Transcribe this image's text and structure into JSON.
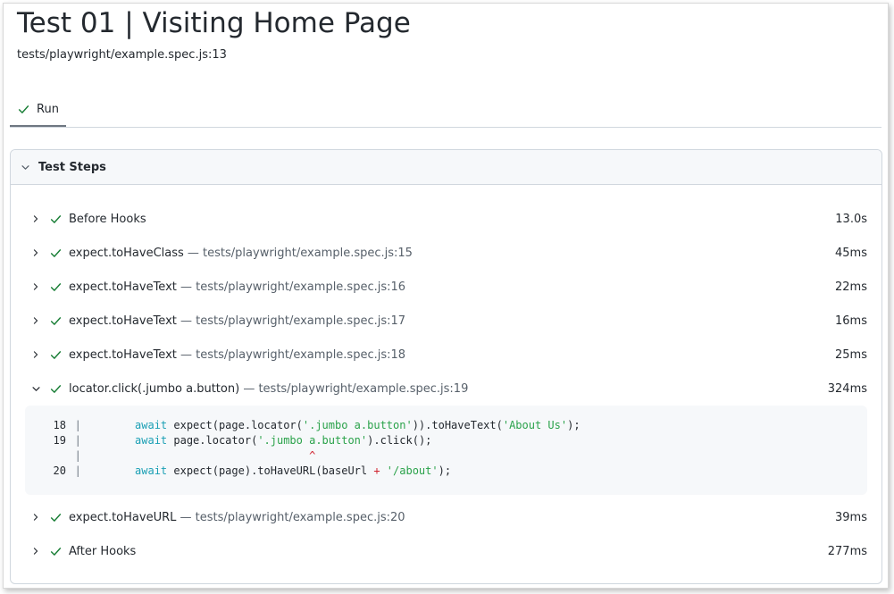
{
  "header": {
    "title": "Test 01 | Visiting Home Page",
    "location": "tests/playwright/example.spec.js:13"
  },
  "tabs": [
    {
      "label": "Run",
      "icon": "check-icon",
      "active": true
    }
  ],
  "panel": {
    "title": "Test Steps",
    "expanded": true
  },
  "colors": {
    "success": "#1a7f37",
    "keyword": "#1a9fb4",
    "string": "#2aa24a",
    "error": "#cf222e"
  },
  "steps": [
    {
      "title": "Before Hooks",
      "location": "",
      "duration": "13.0s",
      "expanded": false
    },
    {
      "title": "expect.toHaveClass",
      "location": "— tests/playwright/example.spec.js:15",
      "duration": "45ms",
      "expanded": false
    },
    {
      "title": "expect.toHaveText",
      "location": "— tests/playwright/example.spec.js:16",
      "duration": "22ms",
      "expanded": false
    },
    {
      "title": "expect.toHaveText",
      "location": "— tests/playwright/example.spec.js:17",
      "duration": "16ms",
      "expanded": false
    },
    {
      "title": "expect.toHaveText",
      "location": "— tests/playwright/example.spec.js:18",
      "duration": "25ms",
      "expanded": false
    },
    {
      "title": "locator.click(.jumbo a.button)",
      "location": "— tests/playwright/example.spec.js:19",
      "duration": "324ms",
      "expanded": true
    },
    {
      "title": "expect.toHaveURL",
      "location": "— tests/playwright/example.spec.js:20",
      "duration": "39ms",
      "expanded": false
    },
    {
      "title": "After Hooks",
      "location": "",
      "duration": "277ms",
      "expanded": false
    }
  ],
  "snippet": {
    "lines": [
      {
        "number": "18",
        "bar": "|",
        "indent": "        ",
        "kw": "await",
        "pre": " expect(page.locator(",
        "str": "'.jumbo a.button'",
        "mid": ")).toHaveText(",
        "str2": "'About Us'",
        "post": ");"
      },
      {
        "number": "19",
        "bar": "|",
        "indent": "        ",
        "kw": "await",
        "pre": " page.locator(",
        "str": "'.jumbo a.button'",
        "mid": ").click();",
        "str2": "",
        "post": ""
      },
      {
        "number": "",
        "bar": "|",
        "caret_indent": "                                   ",
        "caret": "^"
      },
      {
        "number": "20",
        "bar": "|",
        "indent": "        ",
        "kw": "await",
        "pre": " expect(page).toHaveURL(baseUrl ",
        "op": "+",
        "str": " '/about'",
        "post": ");"
      }
    ]
  }
}
